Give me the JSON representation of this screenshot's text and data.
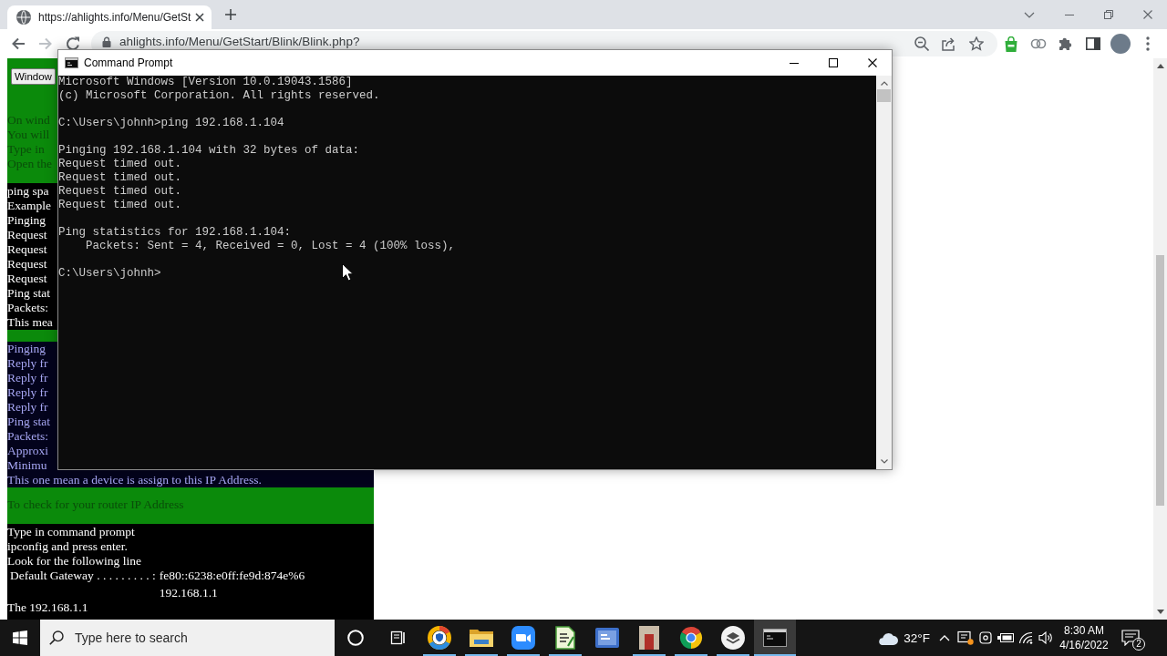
{
  "browser": {
    "tabs": [
      {
        "title": "https://ahlights.info/Menu/GetSt",
        "selected": true
      }
    ],
    "toolbar": {
      "back": {
        "disabled": false
      },
      "forward": {
        "disabled": true
      },
      "address": "ahlights.info/Menu/GetStart/Blink/Blink.php?"
    }
  },
  "page": {
    "sections": [
      {
        "kind": "green",
        "rows": [
          {
            "kind": "button",
            "label": "Window"
          },
          {
            "kind": "text",
            "text": "On wind"
          },
          {
            "kind": "text",
            "text": "You will"
          },
          {
            "kind": "text",
            "text": "Type in"
          },
          {
            "kind": "text",
            "text": "Open the"
          }
        ]
      },
      {
        "kind": "black",
        "rows": [
          {
            "kind": "text",
            "text": "ping spa"
          },
          {
            "kind": "text",
            "text": "Example"
          },
          {
            "kind": "text",
            "text": "Pinging"
          },
          {
            "kind": "text",
            "text": "Request"
          },
          {
            "kind": "text",
            "text": "Request"
          },
          {
            "kind": "text",
            "text": "Request"
          },
          {
            "kind": "text",
            "text": "Request"
          },
          {
            "kind": "text",
            "text": "Ping stat"
          },
          {
            "kind": "text",
            "text": "Packets:"
          },
          {
            "kind": "text",
            "text": "This mea"
          }
        ]
      },
      {
        "kind": "green"
      },
      {
        "kind": "navy",
        "rows": [
          {
            "kind": "text",
            "text": "Pinging"
          },
          {
            "kind": "text",
            "text": "Reply fr"
          },
          {
            "kind": "text",
            "text": "Reply fr"
          },
          {
            "kind": "text",
            "text": "Reply fr"
          },
          {
            "kind": "text",
            "text": "Reply fr"
          },
          {
            "kind": "text",
            "text": "Ping stat"
          },
          {
            "kind": "text",
            "text": "Packets:"
          },
          {
            "kind": "text",
            "text": "Approxi"
          },
          {
            "kind": "text",
            "text": "Minimu"
          },
          {
            "kind": "text",
            "text": "This one mean a device is assign to this IP Address."
          }
        ]
      },
      {
        "kind": "green",
        "rows": [
          {
            "kind": "text",
            "text": "To check for your router IP Address"
          }
        ]
      },
      {
        "kind": "black",
        "rows": [
          {
            "kind": "text",
            "text": "Type in command prompt"
          },
          {
            "kind": "text",
            "text": "ipconfig and press enter."
          },
          {
            "kind": "text",
            "text": "Look for the following line"
          },
          {
            "kind": "gateway",
            "label": "Default Gateway . . . . . . . . . :",
            "values": [
              "fe80::6238:e0ff:fe9d:874e%6",
              "192.168.1.1"
            ]
          },
          {
            "kind": "text",
            "text": "The 192.168.1.1"
          }
        ]
      }
    ]
  },
  "cmd_window": {
    "title": "Command Prompt",
    "blocks": [
      {
        "lines": [
          "Microsoft Windows [Version 10.0.19043.1586]",
          "(c) Microsoft Corporation. All rights reserved."
        ]
      },
      {
        "lines": [
          "C:\\Users\\johnh>ping 192.168.1.104"
        ]
      },
      {
        "lines": [
          "Pinging 192.168.1.104 with 32 bytes of data:",
          "Request timed out.",
          "Request timed out.",
          "Request timed out.",
          "Request timed out."
        ]
      },
      {
        "lines": [
          "Ping statistics for 192.168.1.104:"
        ],
        "sub_lines": [
          "Packets: Sent = 4, Received = 0, Lost = 4 (100% loss),"
        ]
      },
      {
        "lines": [
          "C:\\Users\\johnh>"
        ]
      }
    ]
  },
  "taskbar": {
    "search": {
      "placeholder": "Type here to search"
    },
    "apps": [
      {
        "kind": "shield-browser",
        "running": true,
        "selected": false
      },
      {
        "kind": "folder",
        "running": true,
        "selected": false
      },
      {
        "kind": "video",
        "running": true,
        "selected": false
      },
      {
        "kind": "notepad",
        "running": true,
        "selected": false
      },
      {
        "kind": "tile",
        "running": false,
        "selected": false
      },
      {
        "kind": "picture",
        "running": true,
        "selected": false
      },
      {
        "kind": "browser",
        "running": true,
        "selected": false
      },
      {
        "kind": "layers",
        "running": true,
        "selected": false
      },
      {
        "kind": "terminal",
        "running": true,
        "selected": true
      }
    ],
    "weather": "32°F",
    "time": "8:30 AM",
    "date": "4/16/2022",
    "notifications": "2"
  }
}
